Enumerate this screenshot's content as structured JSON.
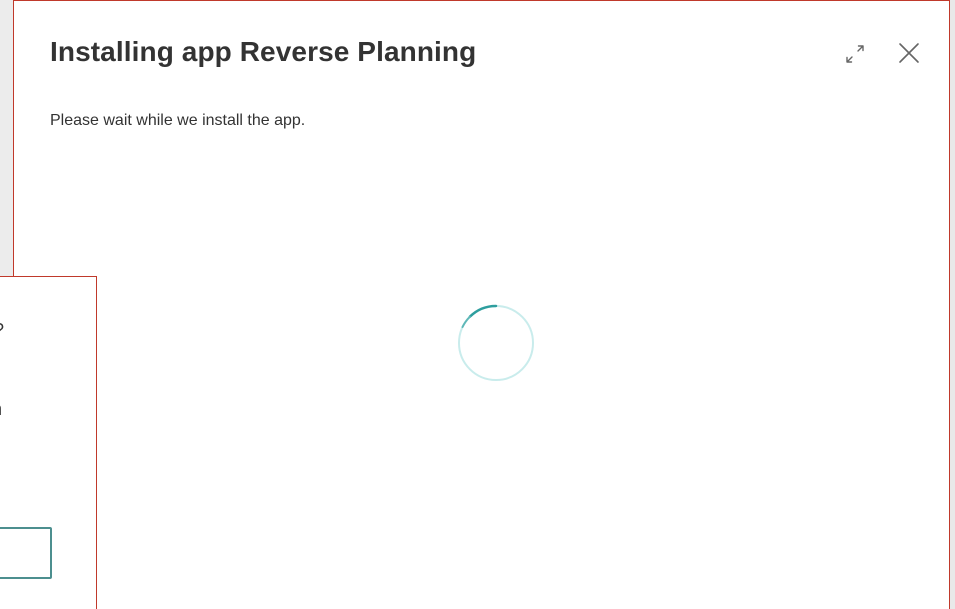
{
  "dialog": {
    "title": "Installing app Reverse Planning",
    "message": "Please wait while we install the app.",
    "expand_icon": "expand-icon",
    "close_icon": "close-icon"
  },
  "background_dialog": {
    "fragment_1": "?",
    "fragment_2": "n"
  },
  "colors": {
    "border_accent": "#c0392b",
    "spinner": "#00a0a0",
    "title_text": "#333333",
    "input_border": "#4c8f8f"
  }
}
